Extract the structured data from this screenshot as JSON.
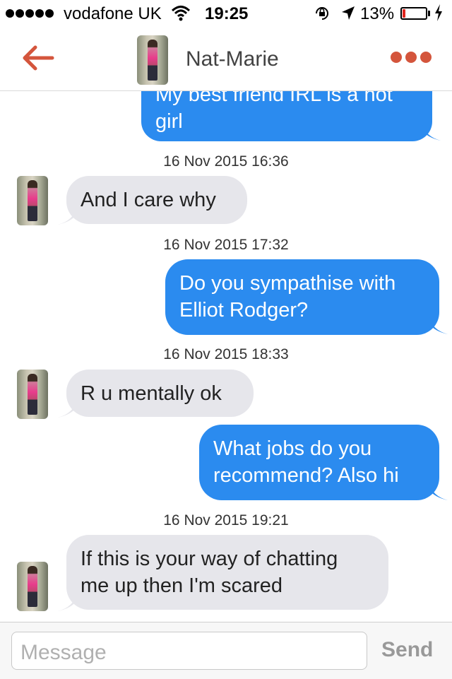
{
  "status_bar": {
    "signal_dots": 5,
    "carrier": "vodafone UK",
    "time": "19:25",
    "battery_percent": "13%",
    "battery_level": 0.13,
    "battery_color": "#e2261f"
  },
  "nav": {
    "title": "Nat-Marie",
    "accent_color": "#d4553c",
    "back_icon": "back-arrow-icon",
    "more_icon": "more-dots-icon"
  },
  "messages": [
    {
      "direction": "outgoing",
      "text": "My best friend IRL is a hot\ngirl"
    },
    {
      "timestamp": "16 Nov 2015 16:36"
    },
    {
      "direction": "incoming",
      "text": "And I care why"
    },
    {
      "timestamp": "16 Nov 2015 17:32"
    },
    {
      "direction": "outgoing",
      "text": "Do you sympathise with\nElliot Rodger?"
    },
    {
      "timestamp": "16 Nov 2015 18:33"
    },
    {
      "direction": "incoming",
      "text": "R u mentally ok"
    },
    {
      "direction": "outgoing",
      "text": "What jobs do you\nrecommend? Also hi"
    },
    {
      "timestamp": "16 Nov 2015 19:21"
    },
    {
      "direction": "incoming",
      "text": "If this is your way of chatting\nme up then I'm scared"
    }
  ],
  "composer": {
    "placeholder": "Message",
    "send_label": "Send"
  },
  "colors": {
    "outgoing_bubble": "#2b8bef",
    "incoming_bubble": "#e6e6eb"
  }
}
